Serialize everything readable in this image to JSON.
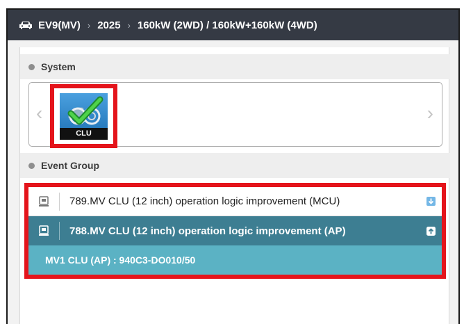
{
  "breadcrumb": {
    "vehicle": "EV9(MV)",
    "year": "2025",
    "power": "160kW (2WD) / 160kW+160kW (4WD)",
    "separator": "›"
  },
  "system": {
    "title": "System",
    "prev_arrow": "‹",
    "next_arrow": "›",
    "tiles": [
      {
        "label": "CLU",
        "icon": "cluster-check-icon"
      }
    ]
  },
  "event_group": {
    "title": "Event Group",
    "items": [
      {
        "title": "789.MV CLU (12 inch) operation logic improvement (MCU)",
        "toggle_icon": "expand-down-icon"
      },
      {
        "title": "788.MV CLU (12 inch) operation logic improvement (AP)",
        "toggle_icon": "collapse-up-icon"
      }
    ],
    "detail": "MV1 CLU (AP) : 940C3-DO010/50"
  },
  "colors": {
    "topbar": "#353a44",
    "highlight": "#e4141b",
    "selected_row": "#3d7e92",
    "detail_row": "#5bb2c4"
  }
}
